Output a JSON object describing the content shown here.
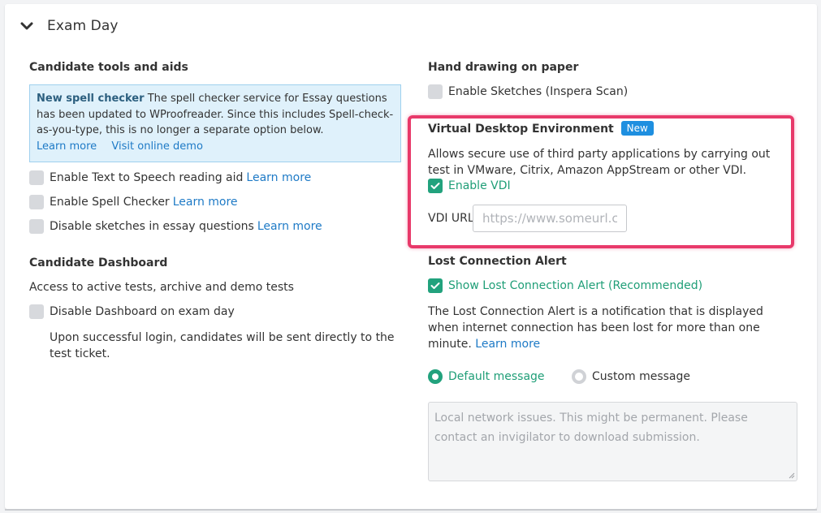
{
  "section": {
    "title": "Exam Day",
    "collapse_icon": "chevron-down-icon"
  },
  "left": {
    "tools_heading": "Candidate tools and aids",
    "info": {
      "title": "New spell checker",
      "body": "The spell checker service for Essay questions has been updated to WProofreader. Since this includes Spell-check-as-you-type, this is no longer a separate option below.",
      "learn_more": "Learn more",
      "demo": "Visit online demo"
    },
    "options": [
      {
        "label": "Enable Text to Speech reading aid",
        "link": "Learn more",
        "checked": false
      },
      {
        "label": "Enable Spell Checker",
        "link": "Learn more",
        "checked": false
      },
      {
        "label": "Disable sketches in essay questions",
        "link": "Learn more",
        "checked": false
      }
    ],
    "dashboard_heading": "Candidate Dashboard",
    "dashboard_desc": "Access to active tests, archive and demo tests",
    "dashboard_option": {
      "label": "Disable Dashboard on exam day",
      "checked": false
    },
    "dashboard_note": "Upon successful login, candidates will be sent directly to the test ticket."
  },
  "right": {
    "hand_heading": "Hand drawing on paper",
    "sketches_option": {
      "label": "Enable Sketches (Inspera Scan)",
      "checked": false
    },
    "vdi": {
      "heading": "Virtual Desktop Environment",
      "badge": "New",
      "desc": "Allows secure use of third party applications by carrying out test in VMware, Citrix, Amazon AppStream or other VDI.",
      "enable_label": "Enable VDI",
      "enabled": true,
      "url_label": "VDI URL",
      "url_placeholder": "https://www.someurl.com",
      "url_value": ""
    },
    "lost": {
      "heading": "Lost Connection Alert",
      "show_label": "Show Lost Connection Alert (Recommended)",
      "show_checked": true,
      "desc": "The Lost Connection Alert is a notification that is displayed when internet connection has been lost for more than one minute.",
      "learn_more": "Learn more",
      "radio_default": "Default message",
      "radio_custom": "Custom message",
      "selected": "default",
      "message": "Local network issues. This might be permanent. Please contact an invigilator to download submission."
    }
  },
  "colors": {
    "accent_green": "#22a27d",
    "link_blue": "#1e7ac6",
    "badge_blue": "#1e8fe0",
    "highlight_pink": "#e8396a",
    "info_bg": "#dff1fb"
  }
}
